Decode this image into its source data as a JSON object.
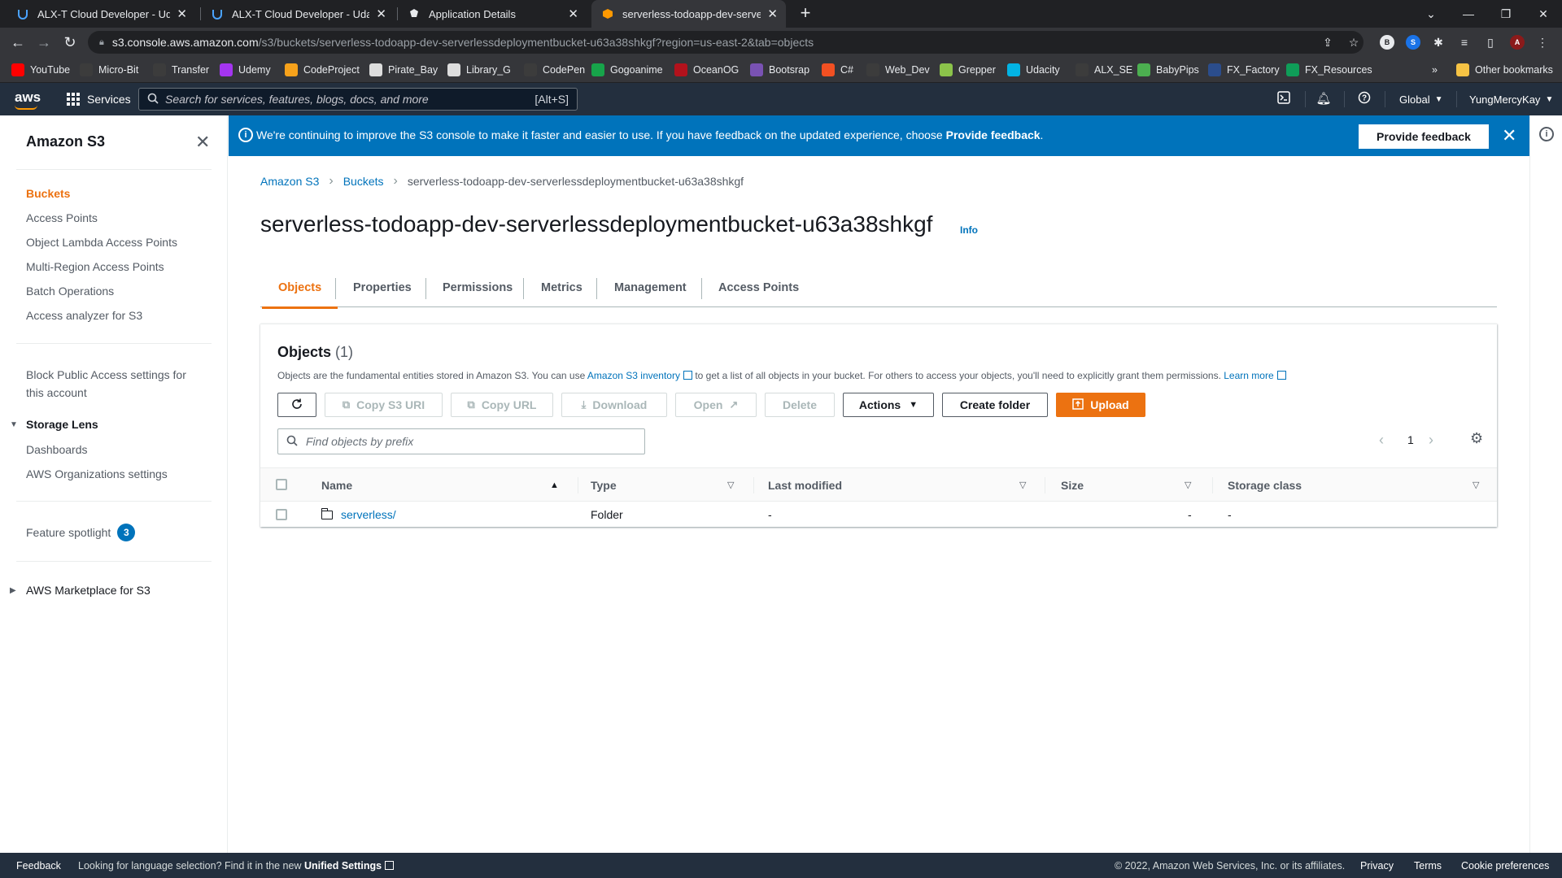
{
  "browser": {
    "tabs": [
      {
        "title": "ALX-T Cloud Developer - Udacity",
        "icon": "udacity-icon"
      },
      {
        "title": "ALX-T Cloud Developer - Udacity",
        "icon": "udacity-icon"
      },
      {
        "title": "Application Details",
        "icon": "auth0-icon"
      },
      {
        "title": "serverless-todoapp-dev-serverle",
        "icon": "aws-s3-icon",
        "active": true
      }
    ],
    "url_host": "s3.console.aws.amazon.com",
    "url_path": "/s3/buckets/serverless-todoapp-dev-serverlessdeploymentbucket-u63a38shkgf?region=us-east-2&tab=objects",
    "profile_initial": "B",
    "bookmarks": [
      {
        "label": "YouTube",
        "color": "#ff0000"
      },
      {
        "label": "Micro-Bit",
        "color": "#3c3c3c"
      },
      {
        "label": "Transfer",
        "color": "#3c3c3c"
      },
      {
        "label": "Udemy",
        "color": "#a435f0"
      },
      {
        "label": "CodeProject",
        "color": "#f7a21b"
      },
      {
        "label": "Pirate_Bay",
        "color": "#dddddd"
      },
      {
        "label": "Library_G",
        "color": "#dddddd"
      },
      {
        "label": "CodePen",
        "color": "#3c3c3c"
      },
      {
        "label": "Gogoanime",
        "color": "#17a44a"
      },
      {
        "label": "OceanOG",
        "color": "#b3121c"
      },
      {
        "label": "Bootsrap",
        "color": "#7952b3"
      },
      {
        "label": "C#",
        "color": "#f25022"
      },
      {
        "label": "Web_Dev",
        "color": "#3c3c3c"
      },
      {
        "label": "Grepper",
        "color": "#8bc34a"
      },
      {
        "label": "Udacity",
        "color": "#02b3e4"
      },
      {
        "label": "ALX_SE",
        "color": "#3c3c3c"
      },
      {
        "label": "BabyPips",
        "color": "#4caf50"
      },
      {
        "label": "FX_Factory",
        "color": "#2b4d8c"
      },
      {
        "label": "FX_Resources",
        "color": "#0f9d58"
      }
    ],
    "other_bookmarks": "Other bookmarks"
  },
  "aws_nav": {
    "logo": "aws",
    "services": "Services",
    "search_placeholder": "Search for services, features, blogs, docs, and more",
    "search_shortcut": "[Alt+S]",
    "region": "Global",
    "user": "YungMercyKay"
  },
  "sidebar": {
    "title": "Amazon S3",
    "items": [
      {
        "label": "Buckets",
        "active": true
      },
      {
        "label": "Access Points"
      },
      {
        "label": "Object Lambda Access Points"
      },
      {
        "label": "Multi-Region Access Points"
      },
      {
        "label": "Batch Operations"
      },
      {
        "label": "Access analyzer for S3"
      }
    ],
    "block_public": "Block Public Access settings for this account",
    "storage_lens": {
      "label": "Storage Lens",
      "items": [
        "Dashboards",
        "AWS Organizations settings"
      ]
    },
    "feature_spotlight": "Feature spotlight",
    "feature_spotlight_count": "3",
    "marketplace": "AWS Marketplace for S3"
  },
  "banner": {
    "message_prefix": "We're continuing to improve the S3 console to make it faster and easier to use. If you have feedback on the updated experience, choose ",
    "message_bold": "Provide feedback",
    "message_suffix": ".",
    "button": "Provide feedback"
  },
  "breadcrumb": [
    "Amazon S3",
    "Buckets",
    "serverless-todoapp-dev-serverlessdeploymentbucket-u63a38shkgf"
  ],
  "page": {
    "title": "serverless-todoapp-dev-serverlessdeploymentbucket-u63a38shkgf",
    "info": "Info"
  },
  "tabs": [
    "Objects",
    "Properties",
    "Permissions",
    "Metrics",
    "Management",
    "Access Points"
  ],
  "objects_panel": {
    "title": "Objects",
    "count": "(1)",
    "desc_1": "Objects are the fundamental entities stored in Amazon S3. You can use ",
    "desc_link": "Amazon S3 inventory",
    "desc_2": " to get a list of all objects in your bucket. For others to access your objects, you'll need to explicitly grant them permissions. ",
    "learn_more": "Learn more",
    "buttons": {
      "copy_uri": "Copy S3 URI",
      "copy_url": "Copy URL",
      "download": "Download",
      "open": "Open",
      "delete": "Delete",
      "actions": "Actions",
      "create_folder": "Create folder",
      "upload": "Upload"
    },
    "filter_placeholder": "Find objects by prefix",
    "page": "1",
    "columns": [
      "Name",
      "Type",
      "Last modified",
      "Size",
      "Storage class"
    ],
    "rows": [
      {
        "name": "serverless/",
        "type": "Folder",
        "last_modified": "-",
        "size": "-",
        "storage_class": "-"
      }
    ]
  },
  "footer": {
    "feedback": "Feedback",
    "lang_prefix": "Looking for language selection? Find it in the new ",
    "lang_link": "Unified Settings",
    "copyright": "© 2022, Amazon Web Services, Inc. or its affiliates.",
    "privacy": "Privacy",
    "terms": "Terms",
    "cookies": "Cookie preferences"
  },
  "colors": {
    "aws_nav": "#232f3e",
    "accent": "#ec7211",
    "link": "#0073bb",
    "banner": "#0073bb"
  }
}
